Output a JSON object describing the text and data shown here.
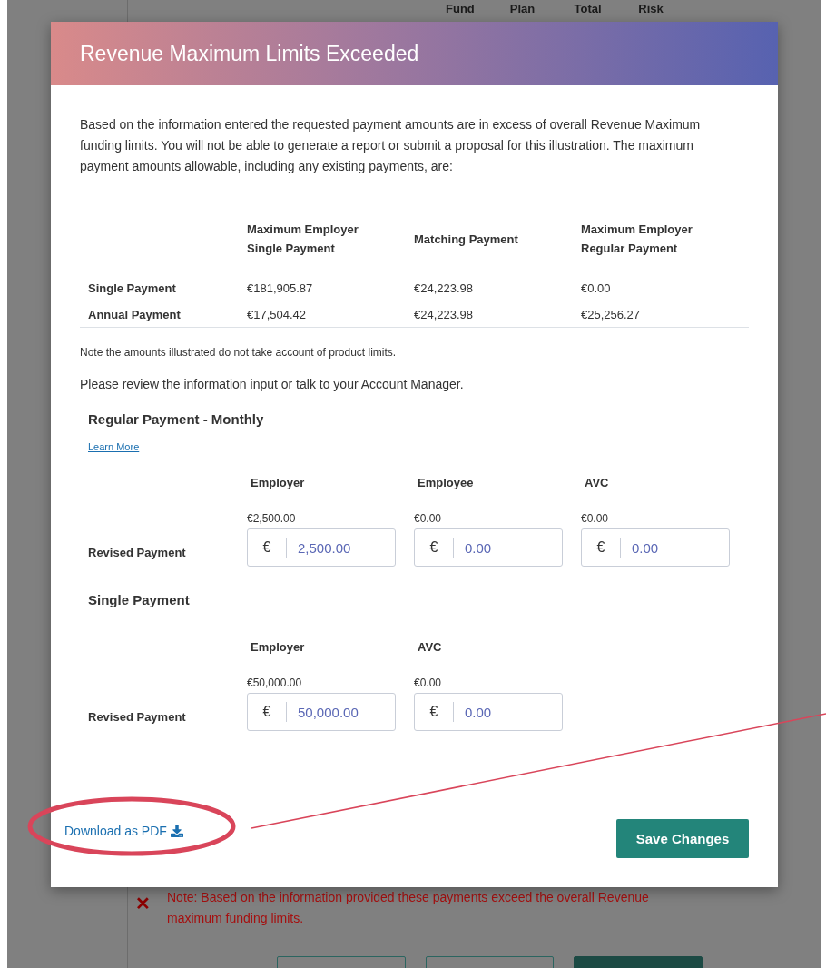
{
  "background": {
    "table_headers": [
      "Fund",
      "Plan",
      "Total",
      "Risk"
    ],
    "error_icon": "✕",
    "error_note": "Note: Based on the information provided these payments exceed the overall Revenue maximum funding limits.",
    "buttons": [
      {
        "kind": "outline"
      },
      {
        "kind": "outline"
      },
      {
        "kind": "filled"
      }
    ]
  },
  "dialog": {
    "title": "Revenue Maximum Limits Exceeded",
    "intro": "Based on the information entered the requested payment amounts are in excess of overall Revenue Maximum funding limits. You will not be able to generate a report or submit a proposal for this illustration. The maximum payment amounts allowable, including any existing payments, are:",
    "limits_table": {
      "columns": [
        "Maximum Employer Single Payment",
        "Matching Payment",
        "Maximum Employer Regular Payment"
      ],
      "rows": [
        {
          "label": "Single Payment",
          "cells": [
            "€181,905.87",
            "€24,223.98",
            "€0.00"
          ]
        },
        {
          "label": "Annual Payment",
          "cells": [
            "€17,504.42",
            "€24,223.98",
            "€25,256.27"
          ]
        }
      ]
    },
    "note": "Note the amounts illustrated do not take account of product limits.",
    "review": "Please review the information input or talk to your Account Manager.",
    "sections": [
      {
        "title": "Regular Payment - Monthly",
        "link": "Learn More",
        "row_label": "Revised Payment",
        "columns": [
          {
            "label": "Employer",
            "current": "€2,500.00",
            "prefix": "€",
            "value": "2,500.00"
          },
          {
            "label": "Employee",
            "current": "€0.00",
            "prefix": "€",
            "value": "0.00"
          },
          {
            "label": "AVC",
            "current": "€0.00",
            "prefix": "€",
            "value": "0.00"
          }
        ]
      },
      {
        "title": "Single Payment",
        "row_label": "Revised Payment",
        "columns": [
          {
            "label": "Employer",
            "current": "€50,000.00",
            "prefix": "€",
            "value": "50,000.00"
          },
          {
            "label": "AVC",
            "current": "€0.00",
            "prefix": "€",
            "value": "0.00"
          }
        ]
      }
    ],
    "download_link": "Download as PDF",
    "save_button": "Save Changes"
  }
}
